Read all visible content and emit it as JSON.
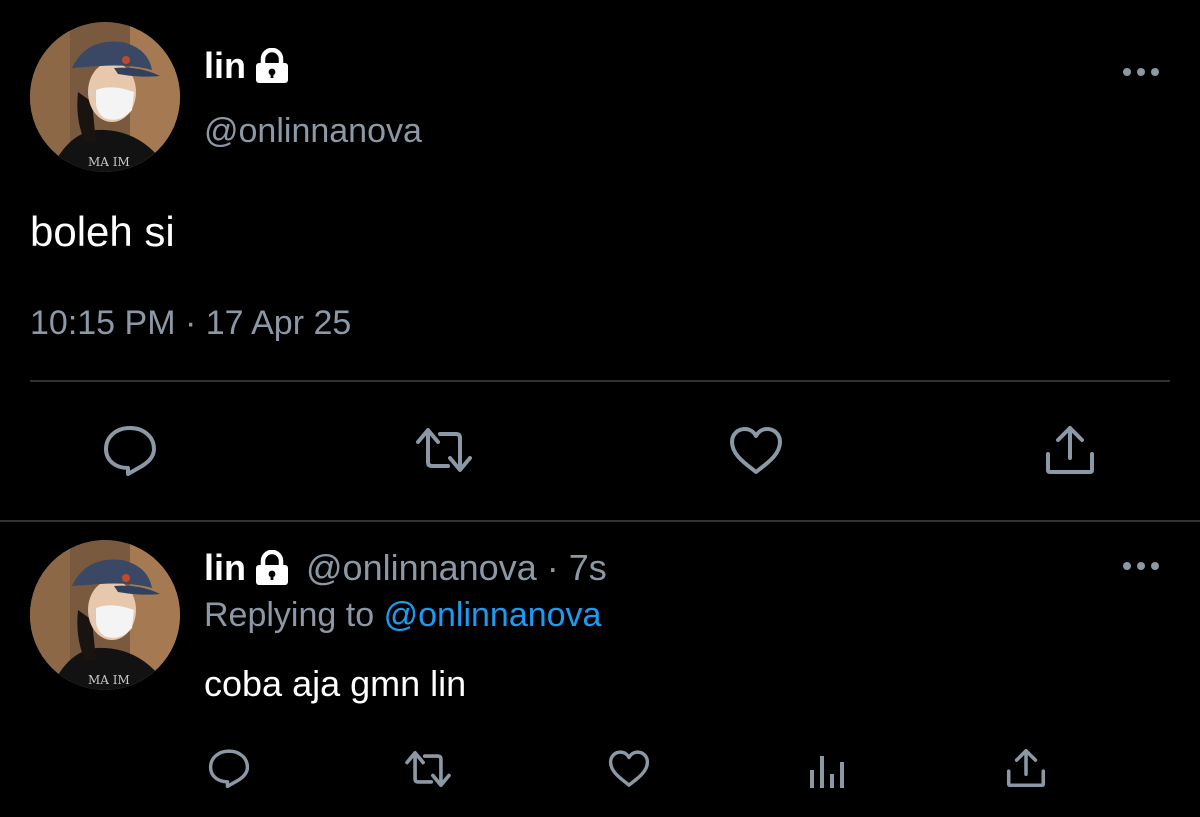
{
  "main_tweet": {
    "display_name": "lin",
    "handle": "@onlinnanova",
    "text": "boleh si",
    "timestamp": "10:15 PM · 17 Apr 25",
    "protected_icon": "lock-icon",
    "actions": [
      "reply-icon",
      "retweet-icon",
      "like-icon",
      "share-icon"
    ]
  },
  "reply_tweet": {
    "display_name": "lin",
    "handle": "@onlinnanova",
    "age": "7s",
    "replying_prefix": "Replying to",
    "replying_to": "@onlinnanova",
    "text": "coba aja gmn lin",
    "protected_icon": "lock-icon",
    "actions": [
      "reply-icon",
      "retweet-icon",
      "like-icon",
      "analytics-icon",
      "share-icon"
    ]
  },
  "colors": {
    "background": "#000000",
    "primary_text": "#ffffff",
    "secondary_text": "#8b98a5",
    "link": "#1d9bf0",
    "divider": "#2f3336",
    "icon": "#8b98a5"
  }
}
